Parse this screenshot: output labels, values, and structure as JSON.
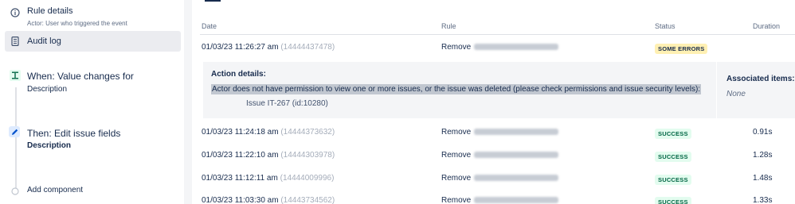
{
  "sidebar": {
    "rule_details": {
      "title": "Rule details",
      "subtitle": "Actor: User who triggered the event"
    },
    "audit_log": {
      "title": "Audit log"
    },
    "steps": [
      {
        "title": "When: Value changes for",
        "subtitle": "Description"
      },
      {
        "title": "Then: Edit issue fields",
        "subtitle": "Description"
      }
    ],
    "add_component": "Add component"
  },
  "table": {
    "headers": {
      "date": "Date",
      "rule": "Rule",
      "status": "Status",
      "duration": "Duration"
    },
    "rows": [
      {
        "date": "01/03/23 11:26:27 am",
        "id": "(14444437478)",
        "rule": "Remove",
        "status": "SOME ERRORS",
        "duration": ""
      },
      {
        "date": "01/03/23 11:24:18 am",
        "id": "(14444373632)",
        "rule": "Remove",
        "status": "SUCCESS",
        "duration": "0.91s"
      },
      {
        "date": "01/03/23 11:22:10 am",
        "id": "(14444303978)",
        "rule": "Remove",
        "status": "SUCCESS",
        "duration": "1.28s"
      },
      {
        "date": "01/03/23 11:12:11 am",
        "id": "(14444009996)",
        "rule": "Remove",
        "status": "SUCCESS",
        "duration": "1.48s"
      },
      {
        "date": "01/03/23 11:03:30 am",
        "id": "(14443734562)",
        "rule": "Remove",
        "status": "SUCCESS",
        "duration": "1.33s"
      }
    ]
  },
  "details": {
    "title": "Action details:",
    "message": "Actor does not have permission to view one or more issues, or the issue was deleted (please check permissions and issue security levels):",
    "issue": "Issue IT-267 (id:10280)",
    "associated_title": "Associated items:",
    "associated_value": "None"
  },
  "colors": {
    "error_lozenge": "#fff0b3",
    "success_lozenge": "#e3fcef",
    "success_text": "#006644",
    "text": "#172b4d",
    "muted": "#a5adba"
  }
}
